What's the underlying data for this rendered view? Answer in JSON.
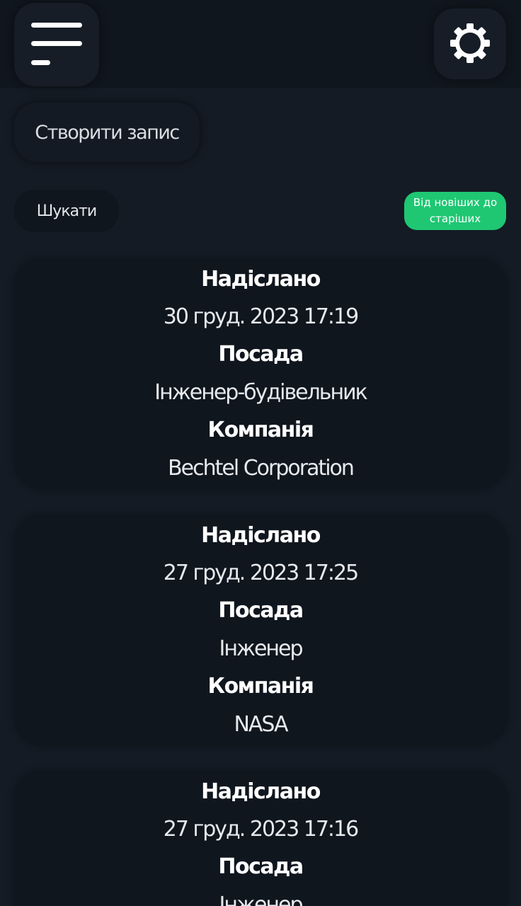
{
  "header": {
    "menu_icon": "hamburger-menu-icon",
    "settings_icon": "gear-icon"
  },
  "actions": {
    "create_label": "Створити запис",
    "search_label": "Шукати",
    "sort_label": "Від новіших до старіших"
  },
  "colors": {
    "background": "#141b24",
    "card": "#10161e",
    "accent": "#1fc773"
  },
  "records": [
    {
      "sent_label": "Надіслано",
      "sent_value": "30 груд. 2023 17:19",
      "position_label": "Посада",
      "position_value": "Інженер-будівельник",
      "company_label": "Компанія",
      "company_value": "Bechtel Corporation"
    },
    {
      "sent_label": "Надіслано",
      "sent_value": "27 груд. 2023 17:25",
      "position_label": "Посада",
      "position_value": "Інженер",
      "company_label": "Компанія",
      "company_value": "NASA"
    },
    {
      "sent_label": "Надіслано",
      "sent_value": "27 груд. 2023 17:16",
      "position_label": "Посада",
      "position_value": "Інженер",
      "company_label": "",
      "company_value": ""
    }
  ]
}
